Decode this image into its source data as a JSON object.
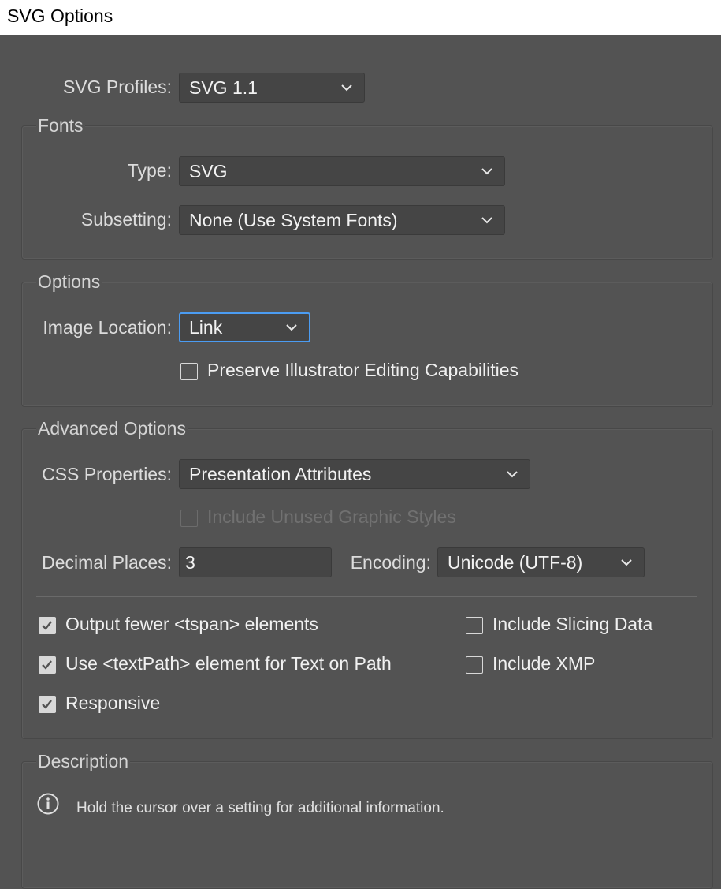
{
  "window": {
    "title": "SVG Options"
  },
  "svg_profiles": {
    "label": "SVG Profiles:",
    "value": "SVG 1.1"
  },
  "fonts": {
    "title": "Fonts",
    "type": {
      "label": "Type:",
      "value": "SVG"
    },
    "subsetting": {
      "label": "Subsetting:",
      "value": "None (Use System Fonts)"
    }
  },
  "options": {
    "title": "Options",
    "image_location": {
      "label": "Image Location:",
      "value": "Link"
    },
    "preserve": {
      "label": "Preserve Illustrator Editing Capabilities",
      "checked": false
    }
  },
  "advanced": {
    "title": "Advanced Options",
    "css_properties": {
      "label": "CSS Properties:",
      "value": "Presentation Attributes"
    },
    "include_unused": {
      "label": "Include Unused Graphic Styles",
      "checked": false,
      "disabled": true
    },
    "decimal_places": {
      "label": "Decimal Places:",
      "value": "3"
    },
    "encoding": {
      "label": "Encoding:",
      "value": "Unicode (UTF-8)"
    },
    "output_fewer": {
      "label": "Output fewer <tspan> elements",
      "checked": true
    },
    "use_textpath": {
      "label": "Use <textPath> element for Text on Path",
      "checked": true
    },
    "responsive": {
      "label": "Responsive",
      "checked": true
    },
    "include_slicing": {
      "label": "Include Slicing Data",
      "checked": false
    },
    "include_xmp": {
      "label": "Include XMP",
      "checked": false
    }
  },
  "description": {
    "title": "Description",
    "icon": "info-icon",
    "text": "Hold the cursor over a setting for additional information."
  },
  "colors": {
    "background": "#535353",
    "control": "#454545",
    "focus": "#4b9cf2"
  }
}
